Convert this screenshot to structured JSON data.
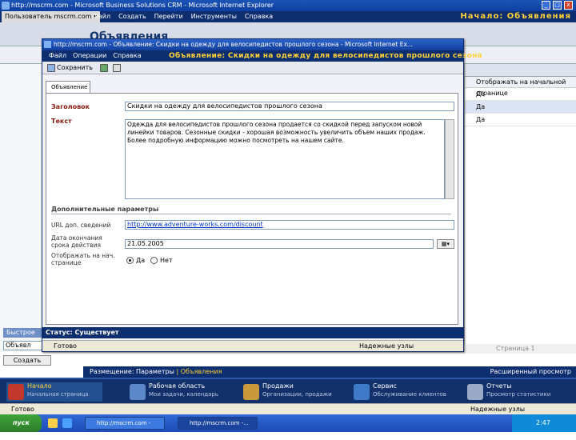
{
  "window": {
    "title": "http://mscrm.com - Microsoft Business Solutions CRM - Microsoft Internet Explorer"
  },
  "menubar": {
    "app_label": "Пользователь mscrm.com ▾",
    "items": [
      "Файл",
      "Создать",
      "Перейти",
      "Инструменты",
      "Справка"
    ],
    "crumb": "Начало: Объявления"
  },
  "page_title": "Объявления",
  "right_grid": {
    "header": "Отображать на начальной странице",
    "rows": [
      "Да",
      "Да",
      "Да"
    ],
    "footer": "Страница 1"
  },
  "quick_search": {
    "title": "Быстрое",
    "input": "Объявл",
    "button": "Создать"
  },
  "footline": {
    "place": "Размещение: Параметры",
    "sep": "|",
    "current": "Объявления",
    "right": "Расширенный просмотр"
  },
  "nav_tiles": [
    {
      "title": "Начало",
      "sub": "Начальная страница"
    },
    {
      "title": "Рабочая область",
      "sub": "Мои задачи, календарь"
    },
    {
      "title": "Продажи",
      "sub": "Организации, продажи"
    },
    {
      "title": "Сервис",
      "sub": "Обслуживание клиентов"
    },
    {
      "title": "Отчеты",
      "sub": "Просмотр статистики"
    }
  ],
  "ie_status": {
    "done": "Готово",
    "zone": "Надежные узлы"
  },
  "taskbar": {
    "start": "пуск",
    "buttons": [
      "http://mscrm.com - Micro...",
      "http://mscrm.com -..."
    ],
    "clock": "2:47"
  },
  "popup": {
    "title": "http://mscrm.com - Объявление: Скидки на одежду для велосипедистов прошлого сезона - Microsoft Internet Ex...",
    "menu": [
      "Файл",
      "Операции",
      "Справка"
    ],
    "heading": "Объявление: Скидки на одежду для велосипедистов прошлого сезона",
    "save_label": "Сохранить",
    "tab": "Объявление",
    "fields": {
      "title_label": "Заголовок",
      "title_value": "Скидки на одежду для велосипедистов прошлого сезона",
      "text_label": "Текст",
      "text_value": "Одежда для велосипедистов прошлого сезона продается со скидкой перед запуском новой линейки товаров. Сезонные скидки - хорошая возможность увеличить объем наших продаж. Более подробную информацию можно посмотреть на нашем сайте.",
      "section": "Дополнительные параметры",
      "url_label": "URL доп. сведений",
      "url_value": "http://www.adventure-works.com/discount",
      "date_label": "Дата окончания срока действия",
      "date_value": "21.05.2005",
      "show_label": "Отображать на нач. странице",
      "yes": "Да",
      "no": "Нет"
    },
    "status": "Статус: Существует",
    "ie_done": "Готово",
    "ie_zone": "Надежные узлы"
  },
  "colors": {
    "brand_dark": "#0c2e6e",
    "accent_yellow": "#ffd23a",
    "label_red": "#8a1a10"
  }
}
